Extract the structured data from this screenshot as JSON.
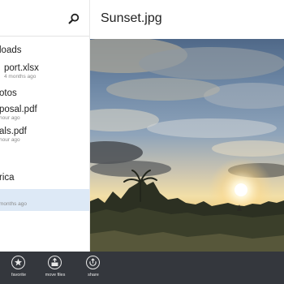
{
  "sidebar": {
    "items": [
      {
        "title": "loads",
        "subtitle": ""
      },
      {
        "title": "port.xlsx",
        "subtitle": "4 months ago"
      },
      {
        "title": "otos",
        "subtitle": ""
      },
      {
        "title": "posal.pdf",
        "subtitle": "hour ago"
      },
      {
        "title": "als.pdf",
        "subtitle": "hour ago"
      },
      {
        "title": "rica",
        "subtitle": ""
      },
      {
        "title": "",
        "subtitle": "months ago"
      }
    ]
  },
  "viewer": {
    "title": "Sunset.jpg"
  },
  "appbar": {
    "favorite_label": "favorite",
    "move_label": "move files",
    "share_label": "share"
  },
  "colors": {
    "appbar_bg": "#34373d",
    "selection": "#dde9f6"
  }
}
